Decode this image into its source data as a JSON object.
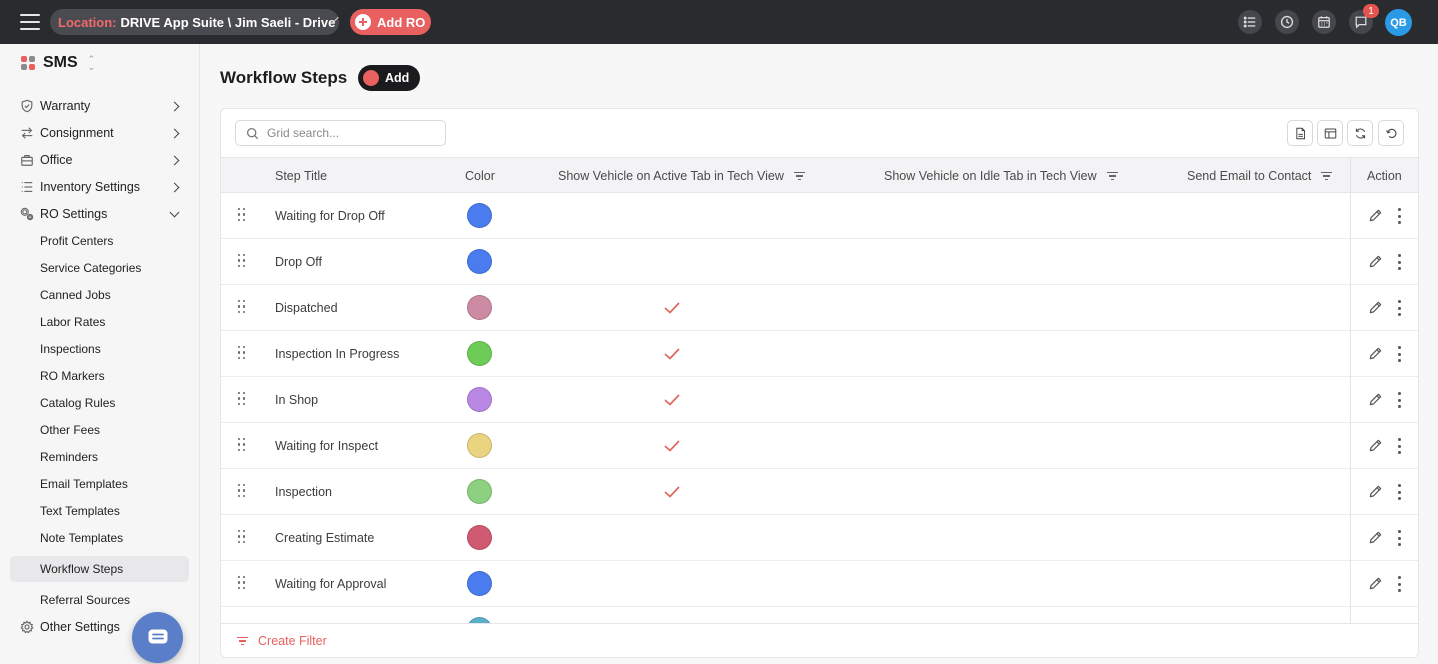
{
  "topbar": {
    "location_label": "Location:",
    "location_value": "DRIVE App Suite \\ Jim Saeli - Drive",
    "add_ro_label": "Add RO",
    "notifications_count": "1",
    "user_initials": "QB"
  },
  "sidebar": {
    "brand": "SMS",
    "items": [
      {
        "label": "Warranty",
        "icon": "shield-icon"
      },
      {
        "label": "Consignment",
        "icon": "swap-arrows-icon"
      },
      {
        "label": "Office",
        "icon": "office-icon"
      },
      {
        "label": "Inventory Settings",
        "icon": "list-settings-icon"
      },
      {
        "label": "RO Settings",
        "icon": "gears-icon"
      }
    ],
    "ro_settings_children": [
      "Profit Centers",
      "Service Categories",
      "Canned Jobs",
      "Labor Rates",
      "Inspections",
      "RO Markers",
      "Catalog Rules",
      "Other Fees",
      "Reminders",
      "Email Templates",
      "Text Templates",
      "Note Templates",
      "Workflow Steps",
      "Referral Sources"
    ],
    "active_child": "Workflow Steps",
    "other_settings": "Other Settings"
  },
  "main": {
    "title": "Workflow Steps",
    "add_label": "Add",
    "search_placeholder": "Grid search...",
    "columns": {
      "title": "Step Title",
      "color": "Color",
      "active_tab": "Show Vehicle on Active Tab in Tech View",
      "idle_tab": "Show Vehicle on Idle Tab in Tech View",
      "send_email": "Send Email to Contact",
      "action": "Action"
    },
    "rows": [
      {
        "title": "Waiting for Drop Off",
        "color": "#4a7cf0",
        "active_tab": false
      },
      {
        "title": "Drop Off",
        "color": "#4a7cf0",
        "active_tab": false
      },
      {
        "title": "Dispatched",
        "color": "#cc8aa3",
        "active_tab": true
      },
      {
        "title": "Inspection In Progress",
        "color": "#6dcc55",
        "active_tab": true
      },
      {
        "title": "In Shop",
        "color": "#b888e4",
        "active_tab": true
      },
      {
        "title": "Waiting for Inspect",
        "color": "#ead47f",
        "active_tab": true
      },
      {
        "title": "Inspection",
        "color": "#8dd07f",
        "active_tab": true
      },
      {
        "title": "Creating Estimate",
        "color": "#d05a72",
        "active_tab": false
      },
      {
        "title": "Waiting for Approval",
        "color": "#4a7cf0",
        "active_tab": false
      }
    ],
    "partial_row_color": "#5ab0c8",
    "create_filter_label": "Create Filter"
  },
  "colors": {
    "accent": "#e8605f",
    "topbar": "#2a2b2f",
    "avatar": "#2b9ae6"
  }
}
